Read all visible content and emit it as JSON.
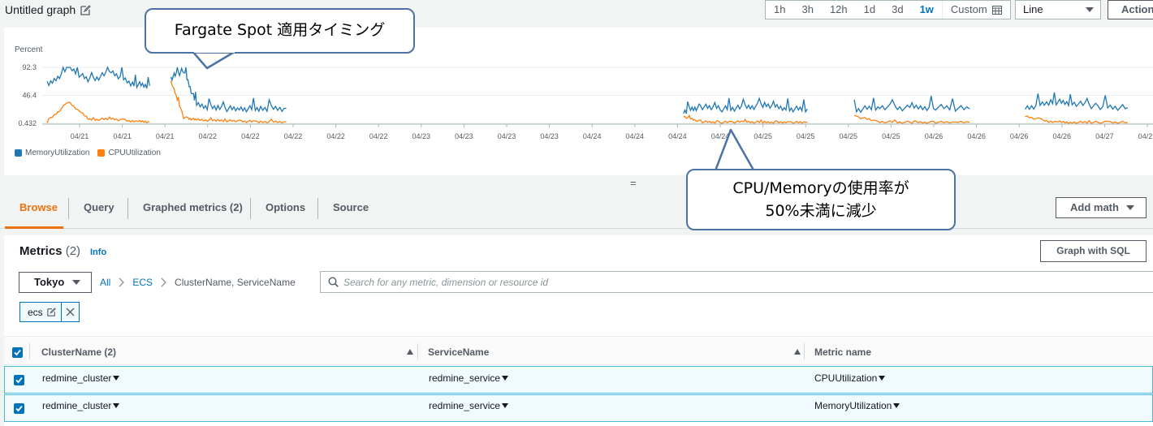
{
  "header": {
    "graph_title": "Untitled graph",
    "time_ranges": [
      "1h",
      "3h",
      "12h",
      "1d",
      "3d",
      "1w"
    ],
    "active_range": "1w",
    "custom_label": "Custom",
    "chart_type_select": "Line",
    "actions_label": "Action"
  },
  "chart_data": {
    "type": "line",
    "ylabel": "Percent",
    "y_ticks": [
      "92.3",
      "46.4",
      "0.432"
    ],
    "ylim": [
      0.432,
      92.3
    ],
    "x_tick_labels": [
      "04/21",
      "04/21",
      "04/21",
      "04/22",
      "04/22",
      "04/22",
      "04/22",
      "04/22",
      "04/23",
      "04/23",
      "04/23",
      "04/23",
      "04/24",
      "04/24",
      "04/24",
      "04/24",
      "04/25",
      "04/25",
      "04/25",
      "04/25",
      "04/26",
      "04/26",
      "04/26",
      "04/26",
      "04/27",
      "04/27",
      "04/2"
    ],
    "grid": true,
    "legend_position": "bottom-left",
    "series": [
      {
        "name": "MemoryUtilization",
        "color": "#1f77b4",
        "segments": [
          {
            "x": [
              0.0,
              0.5,
              1.0,
              1.5,
              2.0,
              2.4
            ],
            "y": [
              60,
              92,
              70,
              85,
              65,
              62
            ]
          },
          {
            "x": [
              2.9,
              3.2,
              3.5,
              4.0,
              4.5,
              5.0,
              5.6
            ],
            "y": [
              75,
              88,
              30,
              25,
              24,
              25,
              25
            ]
          },
          {
            "x": [
              14.9,
              15.3,
              15.8,
              16.3,
              16.8,
              17.3,
              17.8
            ],
            "y": [
              20,
              28,
              24,
              26,
              30,
              24,
              24
            ]
          },
          {
            "x": [
              18.9,
              19.5,
              20.2,
              20.8,
              21.6
            ],
            "y": [
              22,
              28,
              25,
              27,
              24
            ]
          },
          {
            "x": [
              22.9,
              23.5,
              24.0,
              24.6,
              25.3
            ],
            "y": [
              25,
              36,
              34,
              28,
              26
            ]
          }
        ]
      },
      {
        "name": "CPUUtilization",
        "color": "#ff7f0e",
        "segments": [
          {
            "x": [
              0.0,
              0.5,
              1.0,
              1.5,
              2.0,
              2.4
            ],
            "y": [
              3,
              35,
              6,
              8,
              4,
              3
            ]
          },
          {
            "x": [
              2.9,
              3.2,
              3.5,
              4.0,
              4.5,
              5.0,
              5.6
            ],
            "y": [
              70,
              10,
              6,
              5,
              4,
              3,
              3
            ]
          },
          {
            "x": [
              14.9,
              15.3,
              15.8,
              16.3,
              16.8,
              17.3,
              17.8
            ],
            "y": [
              12,
              3,
              2,
              3,
              2,
              2,
              2
            ]
          },
          {
            "x": [
              18.9,
              19.5,
              20.2,
              20.8,
              21.6
            ],
            "y": [
              12,
              3,
              2,
              2,
              2
            ]
          },
          {
            "x": [
              22.9,
              23.5,
              24.0,
              24.6,
              25.3
            ],
            "y": [
              12,
              3,
              2,
              2,
              2
            ]
          }
        ]
      }
    ]
  },
  "callouts": {
    "fargate": "Fargate Spot 適用タイミング",
    "cpu_line1": "CPU/Memoryの使用率が",
    "cpu_line2": "50%未満に減少"
  },
  "resize_handle": "=",
  "tabs": [
    {
      "label": "Browse",
      "active": true
    },
    {
      "label": "Query",
      "active": false
    },
    {
      "label": "Graphed metrics (2)",
      "active": false
    },
    {
      "label": "Options",
      "active": false
    },
    {
      "label": "Source",
      "active": false
    }
  ],
  "add_math_label": "Add math",
  "metrics": {
    "title": "Metrics",
    "count": "(2)",
    "info_label": "Info",
    "graph_sql_label": "Graph with SQL",
    "region": "Tokyo",
    "breadcrumbs": {
      "all": "All",
      "ecs": "ECS",
      "dims": "ClusterName, ServiceName"
    },
    "search_placeholder": "Search for any metric, dimension or resource id",
    "token": "ecs"
  },
  "table": {
    "headers": [
      "ClusterName (2)",
      "ServiceName",
      "Metric name"
    ],
    "rows": [
      {
        "cluster": "redmine_cluster",
        "service": "redmine_service",
        "metric": "CPUUtilization"
      },
      {
        "cluster": "redmine_cluster",
        "service": "redmine_service",
        "metric": "MemoryUtilization"
      }
    ]
  },
  "colors": {
    "accent": "#ec7211",
    "link": "#0073bb",
    "memory": "#1f77b4",
    "cpu": "#ff7f0e"
  }
}
